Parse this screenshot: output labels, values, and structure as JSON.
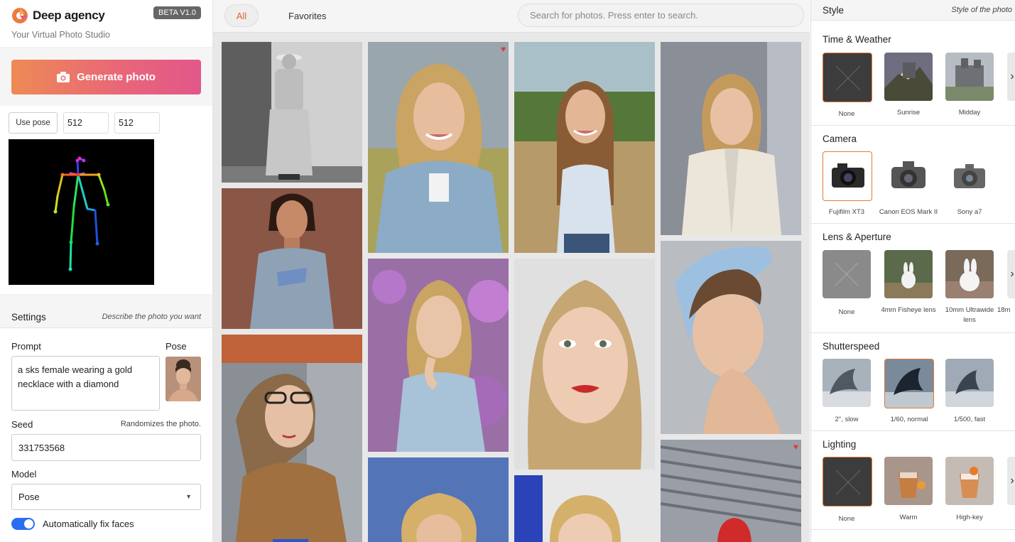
{
  "brand": {
    "name": "Deep agency",
    "badge": "BETA V1.0",
    "tagline": "Your Virtual Photo Studio"
  },
  "generate": {
    "label": "Generate photo"
  },
  "pose_controls": {
    "use_pose_label": "Use pose",
    "width": "512",
    "height": "512"
  },
  "settings": {
    "title": "Settings",
    "subtitle": "Describe the photo you want",
    "prompt_label": "Prompt",
    "prompt_value": "a sks female wearing a gold necklace with a diamond",
    "pose_label": "Pose",
    "seed_label": "Seed",
    "seed_hint": "Randomizes the photo.",
    "seed_value": "331753568",
    "model_label": "Model",
    "model_value": "Pose",
    "autofix_label": "Automatically fix faces"
  },
  "gallery": {
    "tabs": [
      {
        "label": "All"
      },
      {
        "label": "Favorites"
      }
    ],
    "search_placeholder": "Search for photos. Press enter to search."
  },
  "style": {
    "title": "Style",
    "subtitle": "Style of the photo",
    "sections": [
      {
        "title": "Time & Weather",
        "options": [
          "None",
          "Sunrise",
          "Midday"
        ]
      },
      {
        "title": "Camera",
        "options": [
          "Fujifilm XT3",
          "Canon EOS Mark II",
          "Sony a7"
        ]
      },
      {
        "title": "Lens & Aperture",
        "options": [
          "None",
          "4mm Fisheye lens",
          "10mm Ultrawide lens",
          "18m"
        ]
      },
      {
        "title": "Shutterspeed",
        "options": [
          "2\", slow",
          "1/60, normal",
          "1/500, fast"
        ]
      },
      {
        "title": "Lighting",
        "options": [
          "None",
          "Warm",
          "High-key"
        ]
      }
    ]
  },
  "colors": {
    "accent": "#e0642e",
    "toggle": "#2b6ef0",
    "heart": "#e53935",
    "gradient_start": "#ee8a55",
    "gradient_end": "#e2578a"
  }
}
